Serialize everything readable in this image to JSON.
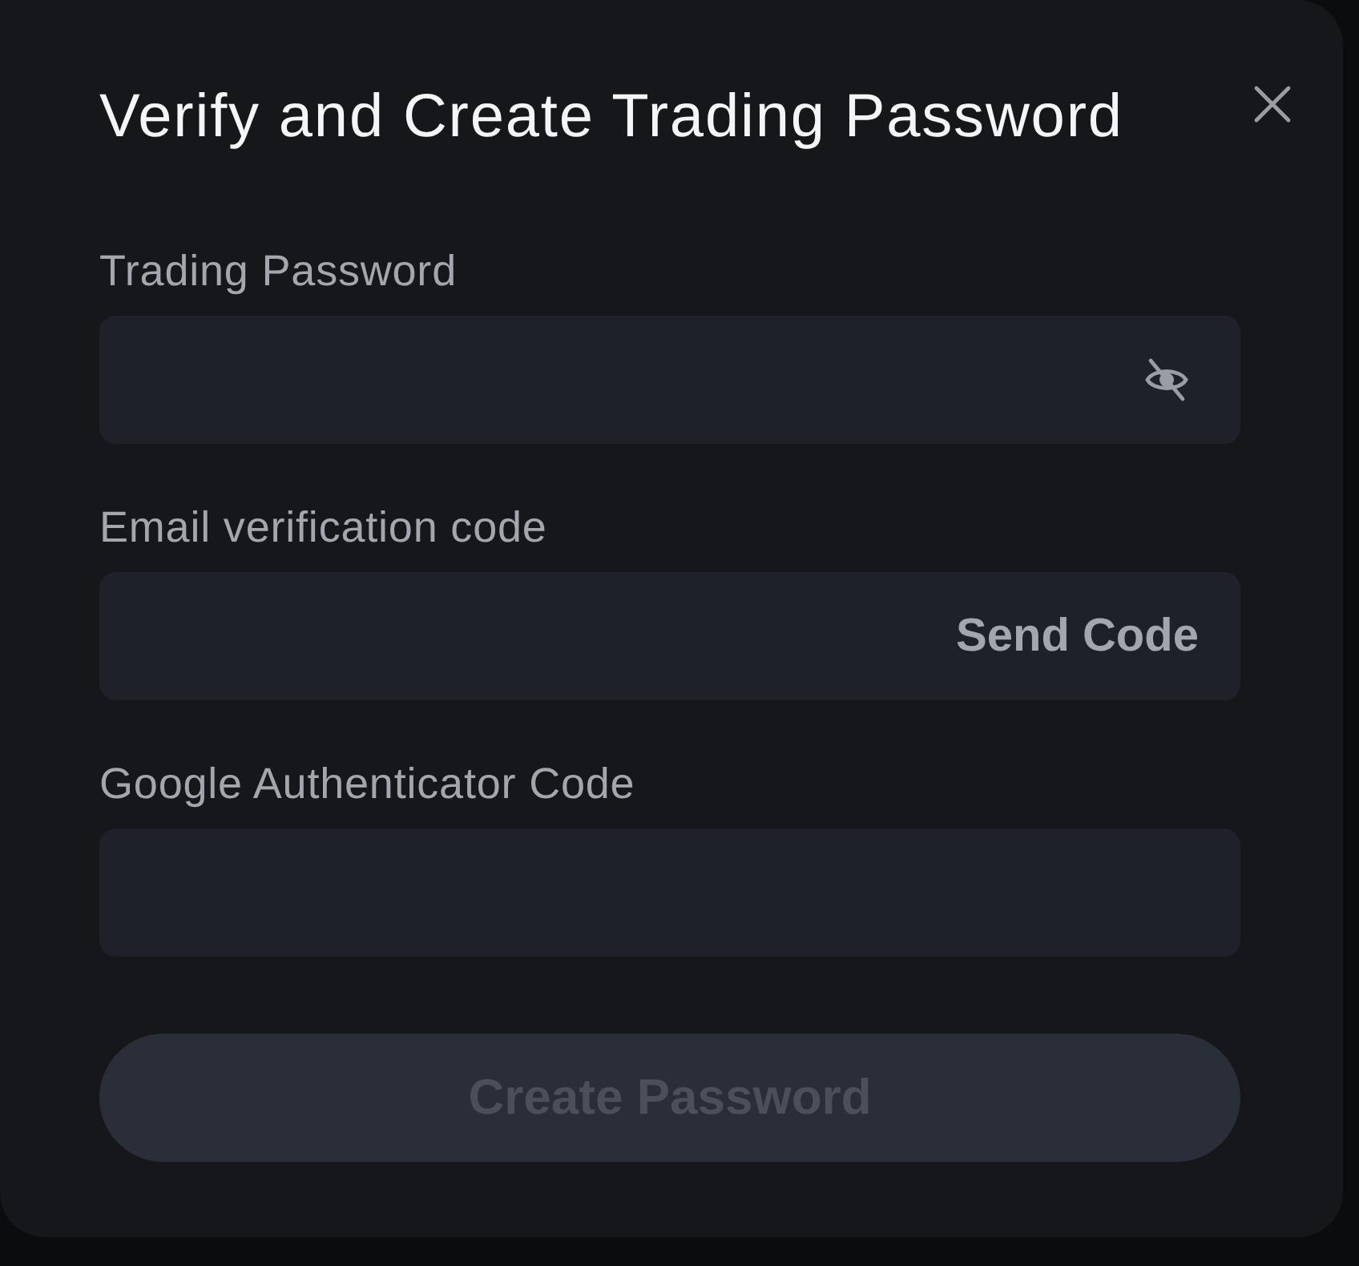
{
  "dialog": {
    "title": "Verify and Create Trading Password"
  },
  "fields": [
    {
      "kind": "password",
      "label": "Trading Password"
    },
    {
      "kind": "code",
      "label": "Email verification code",
      "action": "Send Code"
    },
    {
      "kind": "plain",
      "label": "Google Authenticator Code"
    }
  ],
  "submit": {
    "label": "Create Password",
    "disabled": true
  }
}
